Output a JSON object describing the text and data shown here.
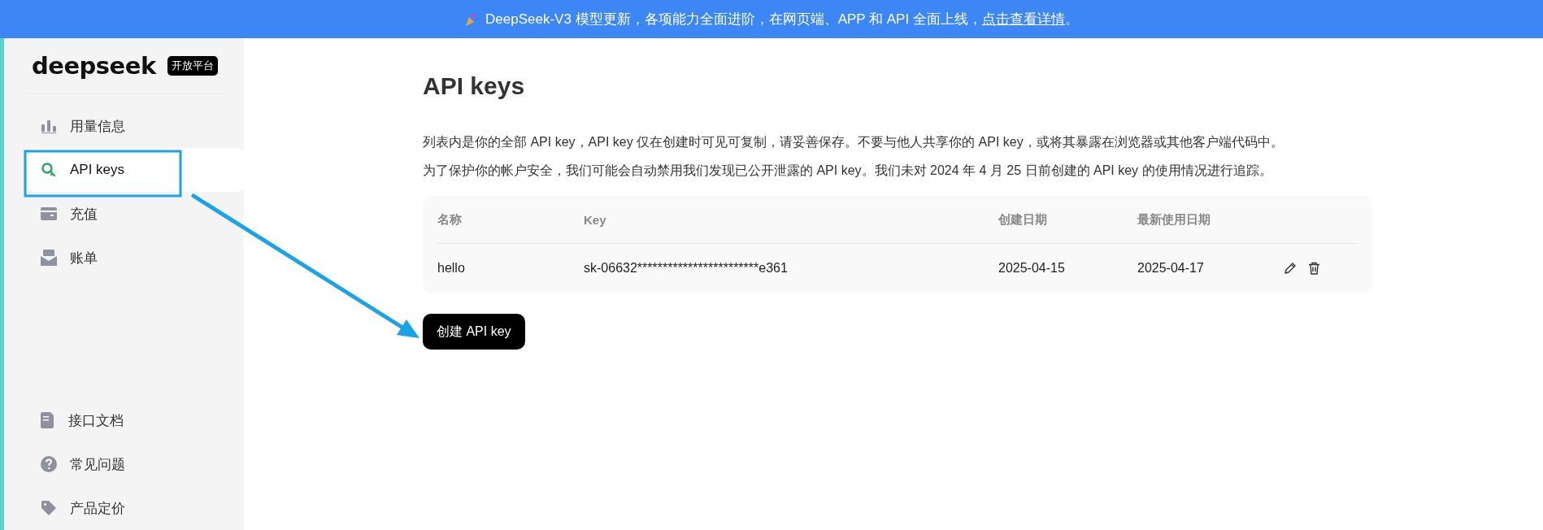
{
  "banner": {
    "text": "DeepSeek-V3 模型更新，各项能力全面进阶，在网页端、APP 和 API 全面上线，",
    "link": "点击查看详情",
    "end": "。"
  },
  "sidebar": {
    "logo": "deepseek",
    "badge": "开放平台",
    "items": [
      {
        "label": "用量信息",
        "selected": false
      },
      {
        "label": "API keys",
        "selected": true
      },
      {
        "label": "充值",
        "selected": false
      },
      {
        "label": "账单",
        "selected": false
      }
    ],
    "bottom_items": [
      {
        "label": "接口文档"
      },
      {
        "label": "常见问题"
      },
      {
        "label": "产品定价"
      }
    ]
  },
  "page": {
    "title": "API keys",
    "description": [
      "列表内是你的全部 API key，API key 仅在创建时可见可复制，请妥善保存。不要与他人共享你的 API key，或将其暴露在浏览器或其他客户端代码中。",
      "为了保护你的帐户安全，我们可能会自动禁用我们发现已公开泄露的 API key。我们未对 2024 年 4 月 25 日前创建的 API key 的使用情况进行追踪。"
    ]
  },
  "table": {
    "columns": [
      "名称",
      "Key",
      "创建日期",
      "最新使用日期"
    ],
    "rows": [
      {
        "name": "hello",
        "key": "sk-06632************************e361",
        "created": "2025-04-15",
        "last_used": "2025-04-17"
      }
    ]
  },
  "create_button": "创建 API key"
}
